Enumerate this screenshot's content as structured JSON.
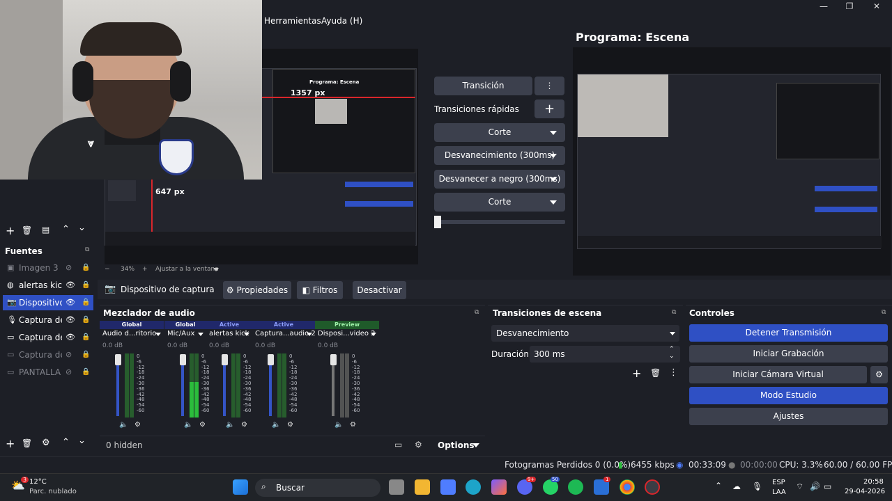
{
  "menubar": {
    "items": [
      "Herramientas",
      "Ayuda (H)"
    ]
  },
  "window_controls": {
    "minimize": "—",
    "maximize": "❐",
    "close": "✕"
  },
  "preview": {
    "inner_title": "Programa: Escena",
    "width_label": "1357 px",
    "height_label": "647 px",
    "zoom": "34%",
    "zoom_minus": "−",
    "zoom_plus": "+",
    "fit_label": "Ajustar a la ventana"
  },
  "transitions_panel": {
    "transition_button": "Transición",
    "quick_label": "Transiciones rápidas",
    "quick_items": [
      "Corte",
      "Desvanecimiento (300ms)",
      "Desvanecer a negro (300ms)",
      "Corte"
    ]
  },
  "program": {
    "title": "Programa: Escena"
  },
  "source_toolbar": {
    "source_name": "Dispositivo de captura de v",
    "properties": "Propiedades",
    "filters": "Filtros",
    "deactivate": "Desactivar"
  },
  "sources": {
    "title": "Fuentes",
    "items": [
      {
        "label": "Imagen 3",
        "icon": "image-icon",
        "visible": false,
        "dim": true
      },
      {
        "label": "alertas kick",
        "icon": "globe-icon",
        "visible": true,
        "dim": false
      },
      {
        "label": "Dispositivo d",
        "icon": "camera-icon",
        "visible": true,
        "dim": false,
        "selected": true
      },
      {
        "label": "Captura de e",
        "icon": "mic-icon",
        "visible": true,
        "dim": false
      },
      {
        "label": "Captura de p",
        "icon": "monitor-icon",
        "visible": true,
        "dim": false
      },
      {
        "label": "Captura de v",
        "icon": "window-icon",
        "visible": false,
        "dim": true
      },
      {
        "label": "PANTALLA R",
        "icon": "monitor-icon",
        "visible": false,
        "dim": true
      }
    ]
  },
  "mixer": {
    "title": "Mezclador de audio",
    "hidden_label": "0 hidden",
    "options_label": "Options",
    "channels": [
      {
        "header": "Global",
        "name": "Audio d...ritorio",
        "db": "0.0 dB",
        "level": 0.0
      },
      {
        "header": "Global",
        "name": "Mic/Aux",
        "db": "0.0 dB",
        "level": 0.55
      },
      {
        "header": "Active",
        "name": "alertas kick",
        "db": "0.0 dB",
        "level": 0.0
      },
      {
        "header": "Active",
        "name": "Captura...audio 2",
        "db": "0.0 dB",
        "level": 0.0
      },
      {
        "header": "Preview",
        "name": "Disposi...video 2",
        "db": "0.0 dB",
        "level": 0.0
      }
    ],
    "scale": [
      "0",
      "-6",
      "-12",
      "-18",
      "-24",
      "-30",
      "-36",
      "-42",
      "-48",
      "-54",
      "-60"
    ]
  },
  "scene_transitions": {
    "title": "Transiciones de escena",
    "selected": "Desvanecimiento",
    "duration_label": "Duración",
    "duration_value": "300 ms"
  },
  "controls": {
    "title": "Controles",
    "buttons": [
      "Detener Transmisión",
      "Iniciar Grabación",
      "Iniciar Cámara Virtual",
      "Modo Estudio",
      "Ajustes"
    ]
  },
  "status": {
    "dropped": "Fotogramas Perdidos 0 (0.0%)",
    "bitrate": "6455 kbps",
    "stream_time": "00:33:09",
    "rec_time": "00:00:00",
    "cpu": "CPU: 3.3%",
    "fps": "60.00 / 60.00 FPS"
  },
  "taskbar": {
    "weather_temp": "12°C",
    "weather_desc": "Parc. nublado",
    "weather_badge": "3",
    "search": "Buscar",
    "lang_top": "ESP",
    "lang_bottom": "LAA",
    "time": "20:58",
    "date": "29-04-2026",
    "badges": [
      "9+",
      "50",
      "1"
    ]
  },
  "colors": {
    "accent": "#2f50c4",
    "panel": "#1d1f26",
    "button": "#3c404d",
    "meter_green": "#2bbd3c"
  }
}
